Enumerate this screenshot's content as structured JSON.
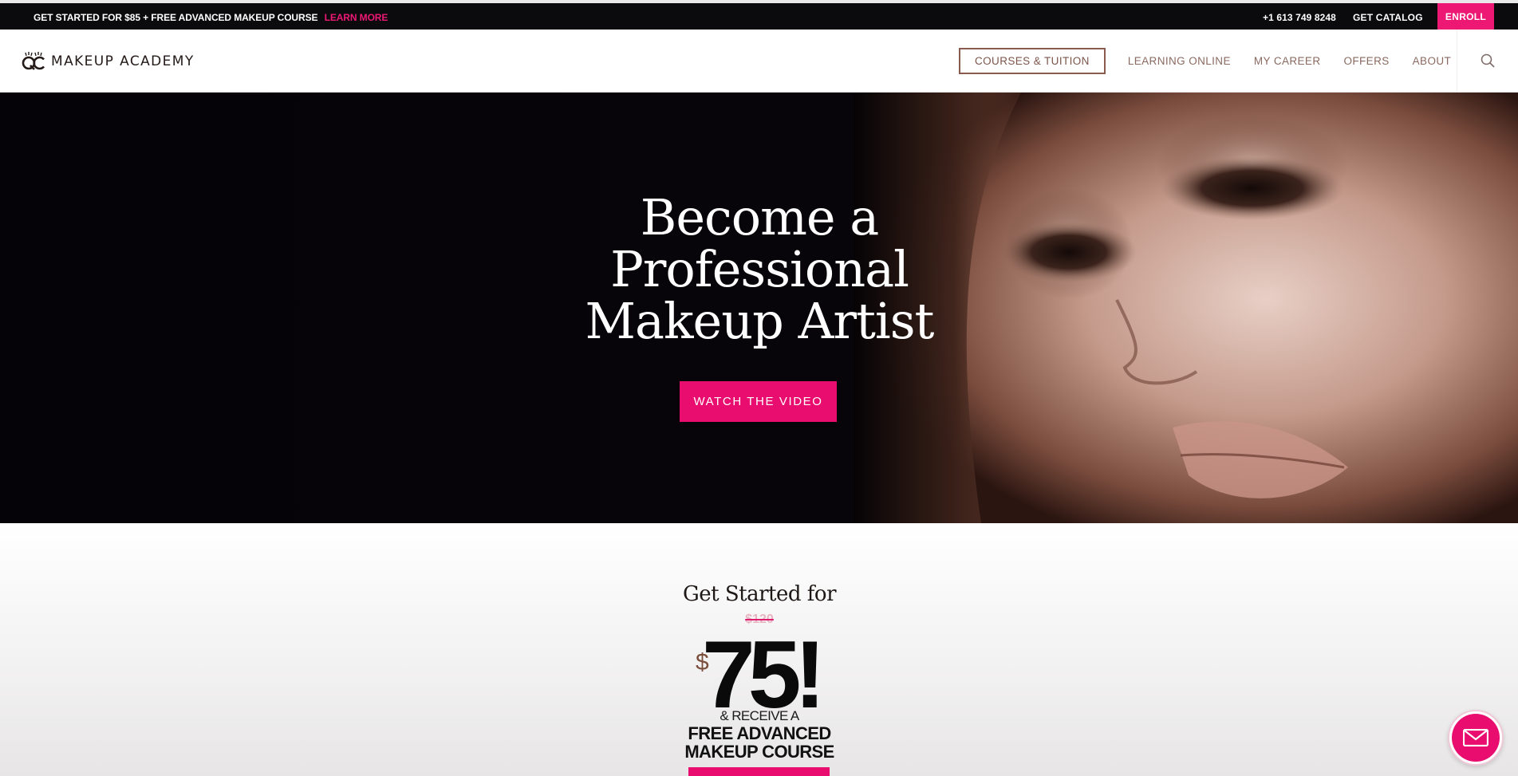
{
  "topbar": {
    "promo": "GET STARTED FOR $85 + FREE ADVANCED MAKEUP COURSE",
    "learn_more": "LEARN MORE",
    "phone": "+1 613 749 8248",
    "catalog": "GET CATALOG",
    "enroll": "ENROLL"
  },
  "header": {
    "logo_text": "MAKEUP ACADEMY",
    "nav": [
      {
        "label": "COURSES & TUITION",
        "active": true
      },
      {
        "label": "LEARNING ONLINE"
      },
      {
        "label": "MY CAREER"
      },
      {
        "label": "OFFERS"
      },
      {
        "label": "ABOUT"
      }
    ],
    "search_icon": "search-icon"
  },
  "hero": {
    "title_line1": "Become a",
    "title_line2": "Professional",
    "title_line3": "Makeup Artist",
    "cta": "WATCH THE VIDEO"
  },
  "offer": {
    "get_started": "Get Started for",
    "old_price": "$120",
    "currency": "$",
    "new_price": "75!",
    "receive": "& RECEIVE A",
    "free_line1": "FREE ADVANCED",
    "free_line2": "MAKEUP COURSE"
  },
  "colors": {
    "accent": "#e90d6f",
    "topbar_bg": "#0b0b0d",
    "nav_text": "#8a6a60"
  },
  "mail_icon": "envelope-icon"
}
